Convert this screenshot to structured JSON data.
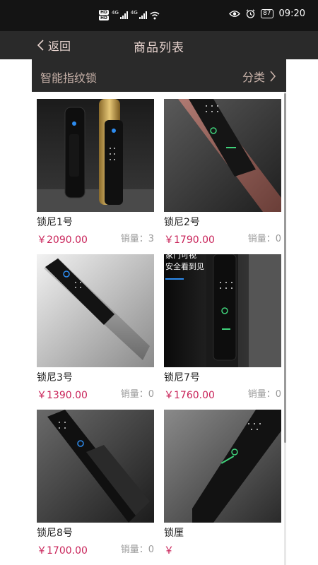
{
  "status_bar": {
    "hd_top": "HD",
    "hd_bottom": "HD",
    "sig1_label": "4G",
    "sig2_label": "4G",
    "battery": "87",
    "time": "09:20",
    "icons": [
      "eye-icon",
      "alarm-icon",
      "wifi-icon",
      "signal-icon"
    ]
  },
  "header": {
    "back_label": "返回",
    "title": "商品列表"
  },
  "category_bar": {
    "title": "智能指纹锁",
    "button_label": "分类"
  },
  "products": [
    {
      "name": "锁尼1号",
      "price": "￥2090.00",
      "sales": "销量：3"
    },
    {
      "name": "锁尼2号",
      "price": "￥1790.00",
      "sales": "销量：0"
    },
    {
      "name": "锁尼3号",
      "price": "￥1390.00",
      "sales": "销量：0"
    },
    {
      "name": "锁尼7号",
      "price": "￥1760.00",
      "sales": "销量：0"
    },
    {
      "name": "锁尼8号",
      "price": "￥1700.00",
      "sales": "销量：0"
    },
    {
      "name": "锁厘",
      "price": "￥",
      "sales": ""
    }
  ],
  "overlay": {
    "line1": "家门可视",
    "line2": "安全看到见"
  },
  "colors": {
    "price": "#c9245a",
    "nav_bg": "#2a2a2a",
    "nav_text": "#e8d4cf",
    "accent_line": "#2d8cf0"
  }
}
